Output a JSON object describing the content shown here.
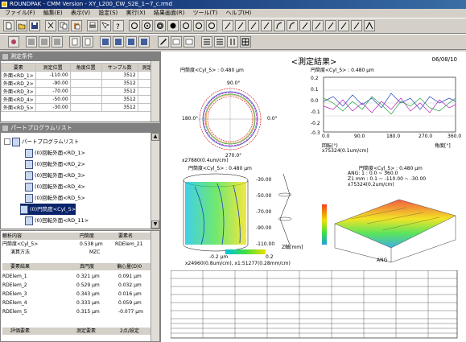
{
  "window": {
    "title": "ROUNDPAK - CMM Version - XY_L200_CW_S2E_1~7_c.rmd"
  },
  "menu": [
    "ファイル(F)",
    "編集(E)",
    "表示(V)",
    "設定(S)",
    "実行(X)",
    "結果画面(R)",
    "ツール(T)",
    "ヘルプ(H)"
  ],
  "conditions_panel": {
    "title": "測定条件",
    "headers": [
      "要素",
      "測定位置",
      "角度位置",
      "サンプル数",
      "測定"
    ],
    "rows": [
      [
        "外面<RD_1>",
        "-110.00",
        "",
        "3512",
        ""
      ],
      [
        "外面<RD_2>",
        "-90.00",
        "",
        "3512",
        ""
      ],
      [
        "外面<RD_3>",
        "-70.00",
        "",
        "3512",
        ""
      ],
      [
        "外面<RD_4>",
        "-50.00",
        "",
        "3512",
        ""
      ],
      [
        "外面<RD_5>",
        "-30.00",
        "",
        "3512",
        ""
      ]
    ]
  },
  "tree_panel": {
    "title": "パートプログラムリスト",
    "root": "パートプログラムリスト",
    "items": [
      "(0)回転外面<RD_1>",
      "(0)回転外面<RD_2>",
      "(0)回転外面<RD_3>",
      "(0)回転外面<RD_4>",
      "(0)回転外面<RD_5>",
      "(0)円筒度<Cyl_5>",
      "(0)回転外面<RD_11>"
    ]
  },
  "analysis_panel": {
    "headers": [
      "解析内容",
      "円筒度",
      "要素名"
    ],
    "main_row": [
      "円筒度<Cyl_5>",
      "0.538 μm",
      "RDElem_21"
    ],
    "method_label": "演算方法",
    "method_value": "MZC",
    "elem_headers": [
      "要素結果",
      "真円度",
      "偏心量(D)0"
    ],
    "elems": [
      [
        "RDElem_1",
        "0.321 μm",
        "0.091 μm"
      ],
      [
        "RDElem_2",
        "0.529 μm",
        "0.032 μm"
      ],
      [
        "RDElem_3",
        "0.343 μm",
        "0.016 μm"
      ],
      [
        "RDElem_4",
        "0.333 μm",
        "0.059 μm"
      ],
      [
        "RDElem_5",
        "0.315 μm",
        "-0.077 μm"
      ]
    ],
    "footer": [
      "評価要素",
      "測定要素",
      "2点/設定"
    ]
  },
  "report": {
    "title": "<測定結果>",
    "date": "06/08/10",
    "polar": {
      "label": "円筒度<Cyl_5> : 0.480 μm",
      "top": "90.0°",
      "left": "180.0°",
      "right": "0.0°",
      "bottom": "270.0°",
      "scale": "x27880(0.4um/cm)"
    },
    "linear": {
      "label": "円筒度<Cyl_5> : 0.480 μm",
      "xlabel": "回転(°)",
      "xunit": "角度[°]",
      "scale": "x75324(0.1um/cm)",
      "yticks": [
        "0.2",
        "0.1",
        "0.0",
        "-0.1",
        "-0.2",
        "-0.3"
      ],
      "xticks": [
        "0.0",
        "90.0",
        "180.0",
        "270.0",
        "360.0"
      ]
    },
    "cylinder": {
      "label": "円筒度<Cyl_5> : 0.480 μm",
      "zticks": [
        "-30.00",
        "-50.00",
        "-70.00",
        "-90.00",
        "-110.00"
      ],
      "zlabel": "Z軸[mm]",
      "scale": "x24960(0.8um/cm), x1:51277(0.28mm/cm)",
      "colorbar_min": "-0.2 μm",
      "colorbar_max": "0.2"
    },
    "surface": {
      "label": "円筒度<Cyl_5> : 0.480 μm",
      "ang": "ANG: 1 : 0.0 ~ 360.0",
      "z": "Z1 mm : 0.1 ~ -110.00 ~ -30.00",
      "scale": "x75324(0.2um/cm)",
      "xlabel": "ANG"
    }
  },
  "colors": {
    "titlebar": "#0a246a",
    "face": "#d4d0c8",
    "panel_head": "#808080"
  }
}
